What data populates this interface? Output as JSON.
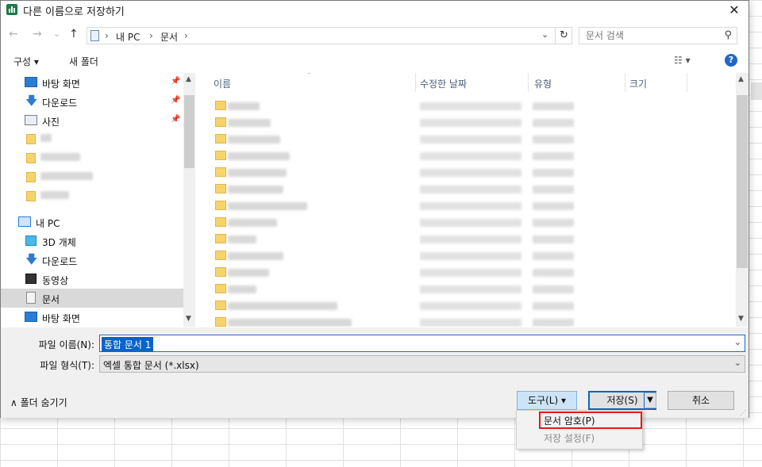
{
  "window": {
    "title": "다른 이름으로 저장하기",
    "close_glyph": "✕"
  },
  "nav": {
    "back_glyph": "←",
    "forward_glyph": "→",
    "recent_glyph": "⌄",
    "up_glyph": "↑",
    "breadcrumb": [
      "내 PC",
      "문서"
    ],
    "separator": "›",
    "refresh_glyph": "↻",
    "search_placeholder": "문서 검색"
  },
  "toolbar": {
    "organize": "구성 ▾",
    "new_folder": "새 폴더",
    "view_glyph": "☷ ▾",
    "help": "?"
  },
  "sidebar": {
    "items": [
      {
        "label": "바탕 화면",
        "icon": "desktop-icon",
        "pinned": true
      },
      {
        "label": "다운로드",
        "icon": "download-icon",
        "pinned": true
      },
      {
        "label": "사진",
        "icon": "pictures-icon",
        "pinned": true
      },
      {
        "label": "",
        "icon": "folder-icon",
        "pinned": false
      },
      {
        "label": "",
        "icon": "folder-icon",
        "pinned": false
      },
      {
        "label": "",
        "icon": "folder-icon",
        "pinned": false
      },
      {
        "label": "",
        "icon": "folder-icon",
        "pinned": false
      },
      {
        "label": "내 PC",
        "icon": "pc-icon",
        "pinned": false
      },
      {
        "label": "3D 개체",
        "icon": "3d-objects-icon",
        "pinned": false
      },
      {
        "label": "다운로드",
        "icon": "download-icon",
        "pinned": false
      },
      {
        "label": "동영상",
        "icon": "video-icon",
        "pinned": false
      },
      {
        "label": "문서",
        "icon": "documents-icon",
        "pinned": false,
        "selected": true
      },
      {
        "label": "바탕 화면",
        "icon": "desktop-icon",
        "pinned": false
      }
    ]
  },
  "filelist": {
    "columns": [
      "이름",
      "수정한 날짜",
      "유형",
      "크기"
    ],
    "rows_blurred_count_note": ""
  },
  "form": {
    "filename_label": "파일 이름(N):",
    "filename_value": "통합 문서 1",
    "filetype_label": "파일 형식(T):",
    "filetype_value": "엑셀 통합 문서 (*.xlsx)",
    "hide_folders": "∧  폴더 숨기기",
    "tools_button": "도구(L)  ▾",
    "save_button": "저장(S)",
    "cancel_button": "취소"
  },
  "tools_menu": {
    "items": [
      {
        "label": "문서 암호(P)",
        "enabled": true,
        "highlighted": true
      },
      {
        "label": "저장 설정(F)",
        "enabled": false
      }
    ]
  },
  "colors": {
    "accent": "#0a64c8",
    "highlight_box": "#e11b1b",
    "excel_green": "#1d7a45"
  }
}
